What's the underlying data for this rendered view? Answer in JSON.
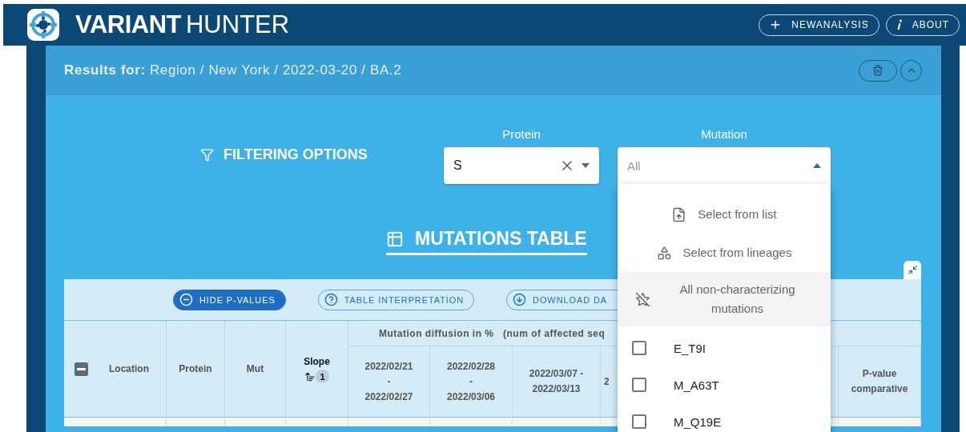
{
  "app": {
    "title_bold": "VARIANT",
    "title_light": "HUNTER"
  },
  "header_buttons": [
    {
      "kind": "add",
      "label": "NEWANALYSIS"
    },
    {
      "kind": "info",
      "label": "ABOUT"
    }
  ],
  "results": {
    "prefix": "Results for:",
    "path": "Region / New York / 2022-03-20 / BA.2"
  },
  "filtering": {
    "title": "FILTERING OPTIONS",
    "protein": {
      "label": "Protein",
      "value": "S"
    },
    "mutation": {
      "label": "Mutation",
      "placeholder": "All",
      "expanded": true
    }
  },
  "mutation_menu": {
    "actions": [
      {
        "kind": "upload",
        "label": "Select from list",
        "selected": false
      },
      {
        "kind": "shapes",
        "label": "Select from lineages",
        "selected": false
      },
      {
        "kind": "star-off",
        "label": "All non-characterizing mutations",
        "selected": true
      }
    ],
    "options": [
      {
        "label": "E_T9I",
        "checked": false
      },
      {
        "label": "M_A63T",
        "checked": false
      },
      {
        "label": "M_Q19E",
        "checked": false
      }
    ]
  },
  "table_section": {
    "title": "MUTATIONS TABLE"
  },
  "table": {
    "toolbar": [
      {
        "kind": "toggle",
        "label": "HIDE P-VALUES",
        "selected": true
      },
      {
        "kind": "help",
        "label": "TABLE INTERPRETATION",
        "selected": false
      },
      {
        "kind": "download",
        "label": "DOWNLOAD DA",
        "selected": false
      }
    ],
    "select_all_indeterminate": true,
    "group_header": "Mutation diffusion in %   (num of affected seq",
    "columns": [
      {
        "label": "Location",
        "sorted": false
      },
      {
        "label": "Protein",
        "sorted": false
      },
      {
        "label": "Mut",
        "sorted": false
      },
      {
        "label": "Slope",
        "sorted": true,
        "sort_rank": "1"
      },
      {
        "label": "2022/02/21\n-\n2022/02/27",
        "sorted": false
      },
      {
        "label": "2022/02/28\n-\n2022/03/06",
        "sorted": false
      },
      {
        "label": "2022/03/07 -\n2022/03/13",
        "sorted": false
      },
      {
        "label": "2",
        "sorted": false
      },
      {
        "label": "P-value\ncomparative",
        "sorted": false
      }
    ]
  }
}
